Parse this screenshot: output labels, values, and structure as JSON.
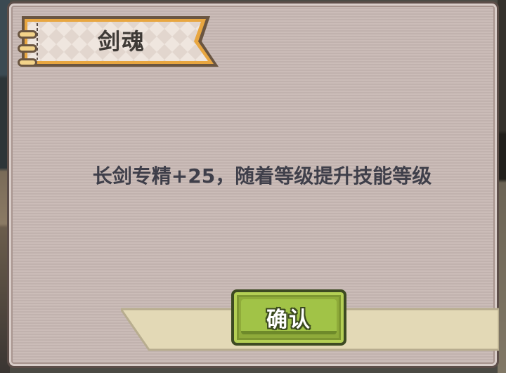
{
  "dialog": {
    "title": "剑魂",
    "message": "长剑专精+25，随着等级提升技能等级",
    "confirm_label": "确认"
  },
  "colors": {
    "panel": "#c8b9b4",
    "ribbon_border": "#e8a640",
    "button": "#a1c347"
  },
  "icons": {
    "rings": "binder-rings-icon"
  }
}
